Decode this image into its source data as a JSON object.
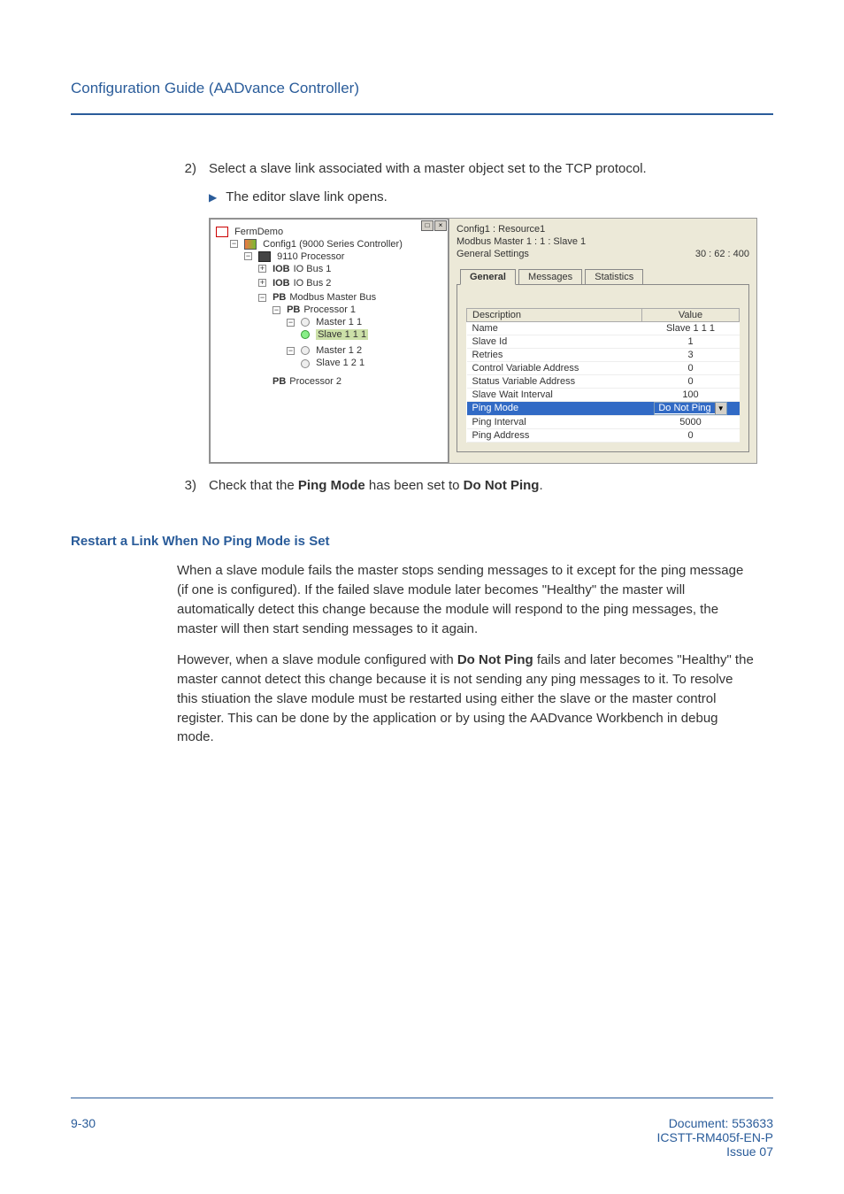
{
  "header": {
    "title": "Configuration Guide (AADvance Controller)"
  },
  "steps": {
    "s2_num": "2)",
    "s2_text": "Select a slave link associated with a master object set to the TCP protocol.",
    "bullet_text": "The editor slave link opens.",
    "s3_num": "3)",
    "s3_pre": "Check that the ",
    "s3_b1": "Ping Mode",
    "s3_mid": " has been set to ",
    "s3_b2": "Do Not Ping",
    "s3_post": "."
  },
  "tree": {
    "root": "FermDemo",
    "config": "Config1 (9000 Series Controller)",
    "proc1": "9110 Processor",
    "iob1_tag": "IOB",
    "iob1": "IO Bus 1",
    "iob2_tag": "IOB",
    "iob2": "IO Bus 2",
    "pb_mb_tag": "PB",
    "pb_mb": "Modbus Master Bus",
    "pb_p1_tag": "PB",
    "pb_p1": "Processor 1",
    "m11": "Master 1 1",
    "s111": "Slave 1 1 1",
    "m12": "Master 1 2",
    "s121": "Slave 1 2 1",
    "pb_p2_tag": "PB",
    "pb_p2": "Processor 2"
  },
  "editor": {
    "path1": "Config1 : Resource1",
    "path2": "Modbus Master 1 : 1 : Slave 1",
    "settings_label": "General Settings",
    "time": "30 : 62 : 400",
    "tabs": {
      "general": "General",
      "messages": "Messages",
      "statistics": "Statistics"
    },
    "cols": {
      "desc": "Description",
      "val": "Value"
    },
    "rows": [
      {
        "d": "Name",
        "v": "Slave 1 1 1"
      },
      {
        "d": "Slave Id",
        "v": "1"
      },
      {
        "d": "Retries",
        "v": "3"
      },
      {
        "d": "Control Variable Address",
        "v": "0"
      },
      {
        "d": "Status Variable Address",
        "v": "0"
      },
      {
        "d": "Slave Wait Interval",
        "v": "100"
      },
      {
        "d": "Ping Mode",
        "v": "Do Not Ping"
      },
      {
        "d": "Ping Interval",
        "v": "5000"
      },
      {
        "d": "Ping Address",
        "v": "0"
      }
    ]
  },
  "section": {
    "heading": "Restart a Link When No Ping Mode is Set",
    "p1": "When a slave module fails the master stops sending messages to it except for the ping message (if one is configured). If the failed slave module later becomes \"Healthy\" the master will automatically detect this change because the module will respond to the ping messages, the master will then start sending messages to it again.",
    "p2_pre": "However, when a slave module configured with ",
    "p2_b": "Do Not Ping",
    "p2_post": " fails and later becomes \"Healthy\" the master cannot detect this change because it is not sending any ping messages to it. To resolve this stiuation the slave module must be restarted using either the slave or the master control register. This can be done by the application or by using the AADvance Workbench in debug mode."
  },
  "footer": {
    "page": "9-30",
    "doc": "Document: 553633",
    "code": "ICSTT-RM405f-EN-P",
    "issue": "Issue 07"
  }
}
